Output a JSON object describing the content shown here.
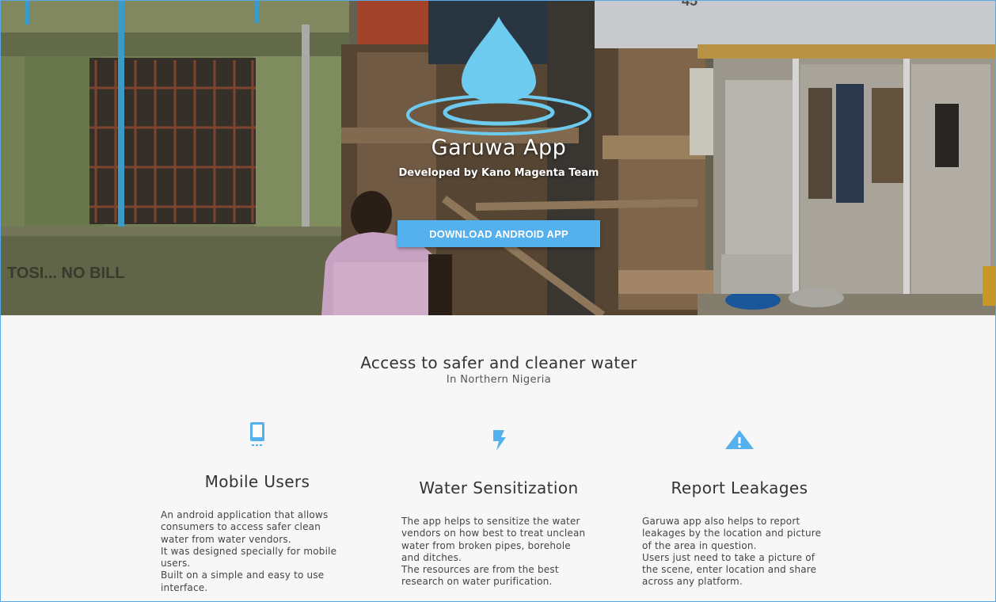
{
  "hero": {
    "title": "Garuwa App",
    "subtitle": "Developed by Kano Magenta Team",
    "download_label": "DOWNLOAD ANDROID APP",
    "logo_icon": "water-drop-icon",
    "background": "street-scene-photo"
  },
  "intro": {
    "title": "Access to safer and cleaner water",
    "subtitle": "In Northern Nigeria"
  },
  "features": [
    {
      "icon": "mobile-phone-icon",
      "title": "Mobile Users",
      "lines": [
        "An android application that allows",
        "consumers to access safer clean",
        "water from water vendors.",
        "It was designed specially for mobile",
        "users.",
        "Built on a simple and easy to use",
        "interface."
      ]
    },
    {
      "icon": "lightning-bolt-icon",
      "title": "Water Sensitization",
      "lines": [
        "The app helps to sensitize the water",
        "vendors on how best to treat unclean",
        "water from broken pipes, borehole",
        "and ditches.",
        "The resources are from the best",
        "research on water purification."
      ]
    },
    {
      "icon": "warning-icon",
      "title": "Report Leakages",
      "lines": [
        "Garuwa app also helps to report",
        "leakages by the location and picture",
        "of the area in question.",
        "Users just need to take a picture of",
        "the scene, enter location and share",
        "across any platform."
      ]
    }
  ],
  "colors": {
    "accent": "#55b0ee",
    "drop": "#6ecbf0",
    "border": "#5aa9e6"
  },
  "photo_text": {
    "wall_sign": "TOSI... NO BILL",
    "house_number": "45"
  }
}
